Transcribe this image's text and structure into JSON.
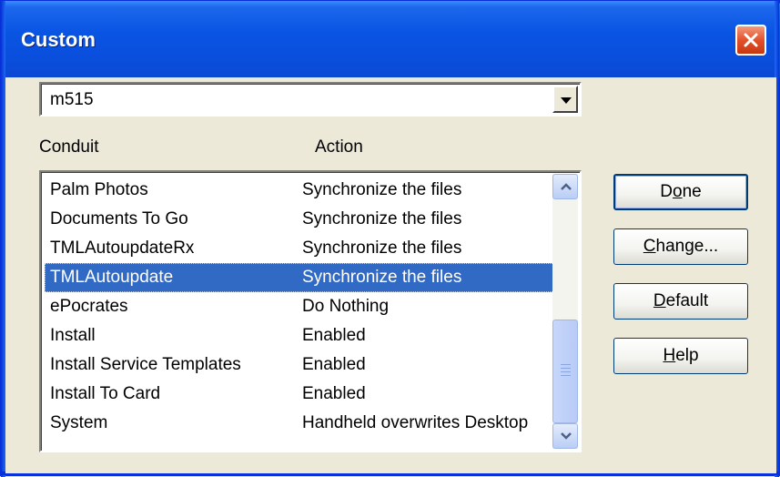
{
  "window": {
    "title": "Custom"
  },
  "profile_combo": {
    "value": "m515"
  },
  "headers": {
    "conduit": "Conduit",
    "action": "Action"
  },
  "rows": [
    {
      "conduit": "Palm Photos",
      "action": "Synchronize the files",
      "selected": false
    },
    {
      "conduit": "Documents To Go",
      "action": "Synchronize the files",
      "selected": false
    },
    {
      "conduit": "TMLAutoupdateRx",
      "action": "Synchronize the files",
      "selected": false
    },
    {
      "conduit": "TMLAutoupdate",
      "action": "Synchronize the files",
      "selected": true
    },
    {
      "conduit": "ePocrates",
      "action": "Do Nothing",
      "selected": false
    },
    {
      "conduit": "Install",
      "action": "Enabled",
      "selected": false
    },
    {
      "conduit": "Install Service Templates",
      "action": "Enabled",
      "selected": false
    },
    {
      "conduit": "Install To Card",
      "action": "Enabled",
      "selected": false
    },
    {
      "conduit": "System",
      "action": "Handheld overwrites Desktop",
      "selected": false
    }
  ],
  "buttons": {
    "done": {
      "pre": "D",
      "key": "o",
      "post": "ne"
    },
    "change": {
      "pre": "",
      "key": "C",
      "post": "hange..."
    },
    "default": {
      "pre": "",
      "key": "D",
      "post": "efault"
    },
    "help": {
      "pre": "",
      "key": "H",
      "post": "elp"
    }
  },
  "icons": {
    "close": "close-icon",
    "dropdown": "chevron-down-icon",
    "scroll_up": "chevron-up-icon",
    "scroll_down": "chevron-down-icon"
  },
  "colors": {
    "titlebar": "#0a4fde",
    "selection": "#316ac5",
    "close": "#e2512c"
  }
}
